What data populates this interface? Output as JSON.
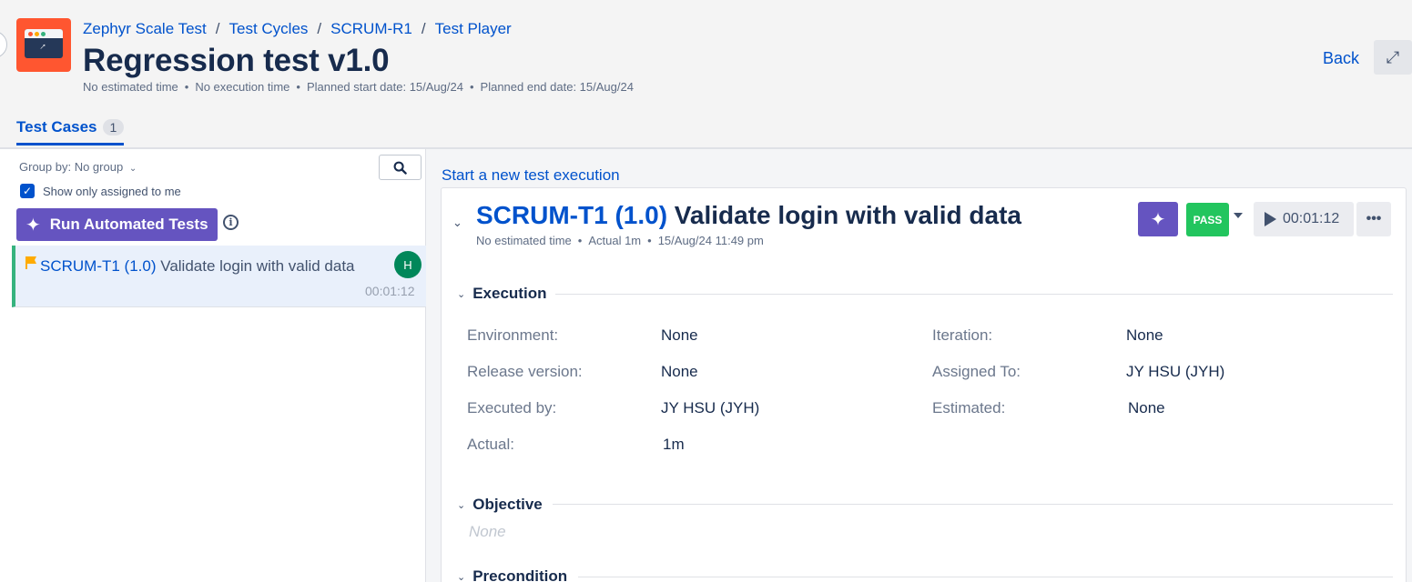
{
  "breadcrumb": [
    "Zephyr Scale Test",
    "Test Cycles",
    "SCRUM-R1",
    "Test Player"
  ],
  "page": {
    "title": "Regression test v1.0",
    "meta": [
      "No estimated time",
      "No execution time",
      "Planned start date: 15/Aug/24",
      "Planned end date: 15/Aug/24"
    ],
    "back_label": "Back"
  },
  "tabs": [
    {
      "label": "Test Cases",
      "count": "1"
    }
  ],
  "left_panel": {
    "group_by": "Group by: No group",
    "assigned_label": "Show only assigned to me",
    "assigned_checked": true,
    "run_button": "Run Automated Tests",
    "cases": [
      {
        "key": "SCRUM-T1 (1.0)",
        "name": "Validate login with valid data",
        "avatar": "H",
        "time": "00:01:12",
        "flag_color": "#ffab00",
        "status_color": "#36b37e"
      }
    ]
  },
  "execution": {
    "start_link": "Start a new test execution",
    "key": "SCRUM-T1 (1.0)",
    "name": "Validate login with valid data",
    "meta": [
      "No estimated time",
      "Actual 1m",
      "15/Aug/24 11:49 pm"
    ],
    "status": "PASS",
    "status_color": "#22c55e",
    "timer": "00:01:12",
    "sections": {
      "execution": "Execution",
      "objective": "Objective",
      "precondition": "Precondition"
    },
    "fields_left": [
      {
        "label": "Environment:",
        "value": "None"
      },
      {
        "label": "Release version:",
        "value": "None"
      },
      {
        "label": "Executed by:",
        "value": "JY HSU (JYH)"
      },
      {
        "label": "Actual:",
        "value": "1m"
      }
    ],
    "fields_right": [
      {
        "label": "Iteration:",
        "value": "None"
      },
      {
        "label": "Assigned To:",
        "value": "JY HSU (JYH)"
      },
      {
        "label": "Estimated:",
        "value": "None"
      }
    ],
    "objective_value": "None"
  }
}
